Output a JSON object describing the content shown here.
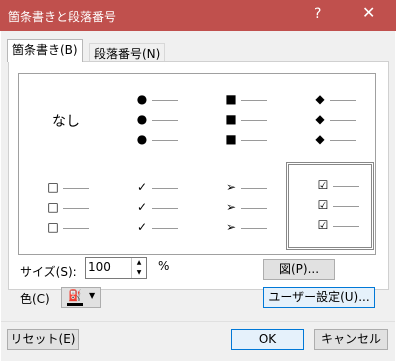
{
  "window": {
    "title": "箇条書きと段落番号",
    "help_glyph": "?",
    "close_glyph": "✕"
  },
  "tabs": [
    {
      "label": "箇条書き(B)",
      "active": true
    },
    {
      "label": "段落番号(N)",
      "active": false
    }
  ],
  "gallery": {
    "none_label": "なし",
    "cells": [
      {
        "symbol": "●"
      },
      {
        "symbol": "■"
      },
      {
        "symbol": "◆"
      },
      {
        "symbol": "□"
      },
      {
        "symbol": "✓"
      },
      {
        "symbol": "➢"
      },
      {
        "symbol": "☑",
        "selected": true
      }
    ]
  },
  "size": {
    "label": "サイズ(S):",
    "value": "100",
    "unit": "%"
  },
  "color": {
    "label": "色(C)",
    "icon": "paint-bucket-icon",
    "value": "#000000"
  },
  "buttons": {
    "picture": "図(P)...",
    "customize": "ユーザー設定(U)...",
    "reset": "リセット(E)",
    "ok": "OK",
    "cancel": "キャンセル"
  },
  "colors": {
    "titlebar": "#c0504d",
    "focus_border": "#0078d7"
  }
}
